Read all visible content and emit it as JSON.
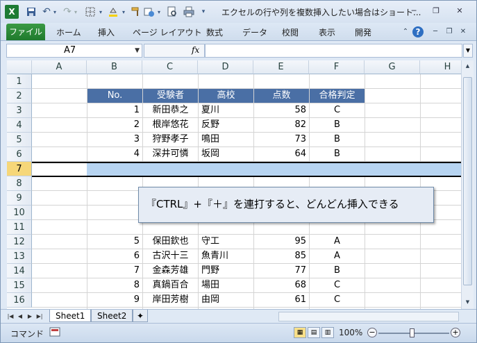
{
  "window": {
    "title": "エクセルの行や列を複数挿入したい場合はショート...",
    "min_label": "─",
    "restore_label": "❐",
    "close_label": "✕"
  },
  "quick_access": {
    "app_icon": "excel-icon",
    "save_icon": "save-icon",
    "undo_icon": "undo-icon",
    "redo_icon": "redo-icon",
    "customize_icon": "chevron-down-icon"
  },
  "ribbon": {
    "file_tab": "ファイル",
    "tabs": [
      "ホーム",
      "挿入",
      "ページ レイアウト",
      "数式",
      "データ",
      "校閲",
      "表示",
      "開発"
    ]
  },
  "formula_bar": {
    "name_box": "A7",
    "fx_label": "fx",
    "formula": ""
  },
  "grid": {
    "columns": [
      "A",
      "B",
      "C",
      "D",
      "E",
      "F",
      "G",
      "H"
    ],
    "rows": [
      "1",
      "2",
      "3",
      "4",
      "5",
      "6",
      "7",
      "8",
      "9",
      "10",
      "11",
      "12",
      "13",
      "14",
      "15",
      "16"
    ],
    "table_headers": [
      "No.",
      "受験者",
      "高校",
      "点数",
      "合格判定"
    ],
    "records": [
      {
        "no": "1",
        "name": "新田恭之",
        "school": "夏川",
        "score": "58",
        "result": "C"
      },
      {
        "no": "2",
        "name": "根岸悠花",
        "school": "反野",
        "score": "82",
        "result": "B"
      },
      {
        "no": "3",
        "name": "狩野孝子",
        "school": "鳴田",
        "score": "73",
        "result": "B"
      },
      {
        "no": "4",
        "name": "深井可憐",
        "school": "坂岡",
        "score": "64",
        "result": "B"
      },
      {
        "no": "5",
        "name": "保田欽也",
        "school": "守工",
        "score": "95",
        "result": "A"
      },
      {
        "no": "6",
        "name": "古沢十三",
        "school": "魚青川",
        "score": "85",
        "result": "A"
      },
      {
        "no": "7",
        "name": "金森芳雄",
        "school": "門野",
        "score": "77",
        "result": "B"
      },
      {
        "no": "8",
        "name": "真鍋百合",
        "school": "場田",
        "score": "68",
        "result": "C"
      },
      {
        "no": "9",
        "name": "岸田芳樹",
        "school": "由岡",
        "score": "61",
        "result": "C"
      }
    ]
  },
  "callout": {
    "text": "『CTRL』+『＋』を連打すると、どんどん挿入できる"
  },
  "sheets": {
    "tabs": [
      "Sheet1",
      "Sheet2"
    ]
  },
  "status_bar": {
    "mode": "コマンド",
    "zoom": "100%",
    "zoom_out": "−",
    "zoom_in": "+"
  }
}
